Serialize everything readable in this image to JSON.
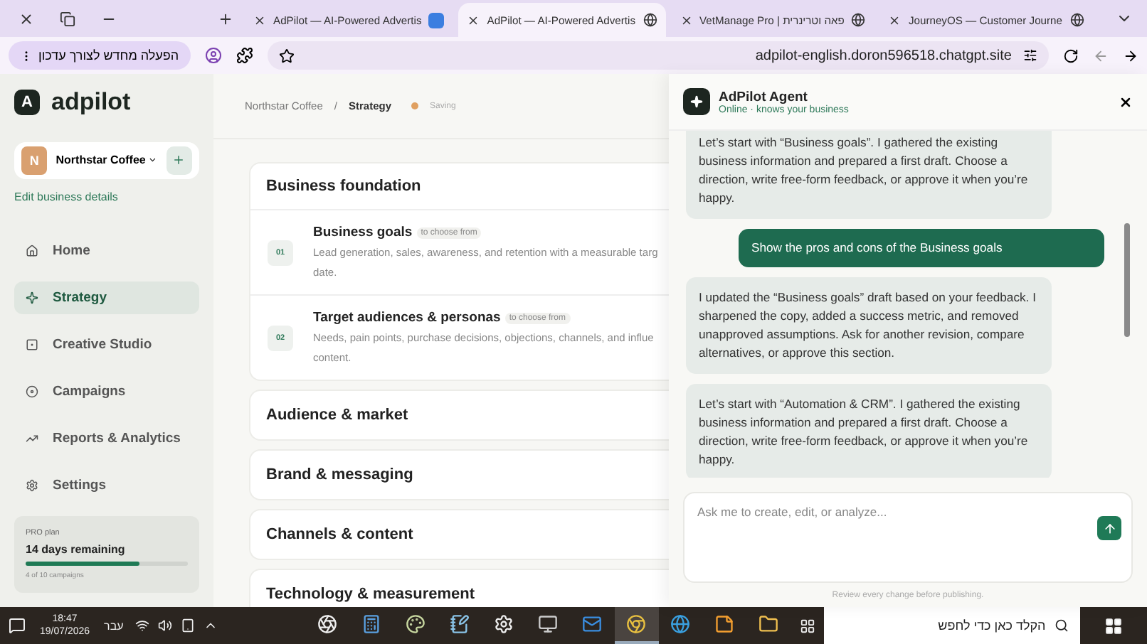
{
  "browser": {
    "tabs": [
      {
        "title": "AdPilot — AI-Powered Advertis",
        "selected": false
      },
      {
        "title": "AdPilot — AI-Powered Advertis",
        "selected": true
      },
      {
        "title": "VetManage Pro | פאה וטרינרית",
        "selected": false
      },
      {
        "title": "JourneyOS — Customer Journe",
        "selected": false
      }
    ],
    "restart_label": "הפעלה מחדש לצורך עדכון",
    "url": "adpilot-english.doron596518.chatgpt.site"
  },
  "sidebar": {
    "logo_letter": "A",
    "brand": "adpilot",
    "business": {
      "initial": "N",
      "name": "Northstar Coffee"
    },
    "edit_link": "Edit business details",
    "nav": [
      {
        "label": "Home",
        "selected": false
      },
      {
        "label": "Strategy",
        "selected": true
      },
      {
        "label": "Creative Studio",
        "selected": false
      },
      {
        "label": "Campaigns",
        "selected": false
      },
      {
        "label": "Reports & Analytics",
        "selected": false
      },
      {
        "label": "Settings",
        "selected": false
      }
    ],
    "plan": {
      "label": "PRO plan",
      "remaining": "14 days remaining",
      "level": 0.7,
      "usage": "4 of 10 campaigns"
    }
  },
  "main": {
    "breadcrumb": [
      "Northstar Coffee",
      "Strategy"
    ],
    "separator": "/",
    "status": "Saving",
    "sections": [
      {
        "title": "Business foundation",
        "expanded": true,
        "steps": [
          {
            "number": "01",
            "title": "Business goals",
            "tag": "to choose from",
            "description_lines": [
              "Lead generation, sales, awareness, and retention with a measurable targ",
              "date."
            ]
          },
          {
            "number": "02",
            "title": "Target audiences & personas",
            "tag": "to choose from",
            "description_lines": [
              "Needs, pain points, purchase decisions, objections, channels, and influe",
              "content."
            ]
          }
        ]
      },
      {
        "title": "Audience & market",
        "expanded": false
      },
      {
        "title": "Brand & messaging",
        "expanded": false
      },
      {
        "title": "Channels & content",
        "expanded": false
      },
      {
        "title": "Technology & measurement",
        "expanded": false
      }
    ]
  },
  "agent": {
    "title": "AdPilot Agent",
    "subtitle": "Online · knows your business",
    "messages": [
      {
        "kind": "agent",
        "text": "Let’s start with “Business goals”. I gathered the existing business information and prepared a first draft. Choose a direction, write free-form feedback, or approve it when you’re happy."
      },
      {
        "kind": "user",
        "text": "Show the pros and cons of the Business goals"
      },
      {
        "kind": "agent",
        "text": "I updated the “Business goals” draft based on your feedback. I sharpened the copy, added a success metric, and removed unapproved assumptions. Ask for another revision, compare alternatives, or approve this section."
      },
      {
        "kind": "agent",
        "text": "Let’s start with “Automation & CRM”. I gathered the existing business information and prepared a first draft. Choose a direction, write free-form feedback, or approve it when you’re happy."
      }
    ],
    "input_placeholder": "Ask me to create, edit, or analyze...",
    "footer_note": "Review every change before publishing."
  },
  "taskbar": {
    "time": "18:47",
    "date": "19/07/2026",
    "language": "עבר",
    "apps": [
      {
        "active": false
      },
      {
        "active": false
      },
      {
        "active": false
      },
      {
        "active": false
      },
      {
        "active": false
      },
      {
        "active": false
      },
      {
        "active": false
      },
      {
        "active": true
      },
      {
        "active": false
      },
      {
        "active": false
      },
      {
        "active": false
      }
    ],
    "search_placeholder": "הקלד כאן כדי לחפש"
  }
}
